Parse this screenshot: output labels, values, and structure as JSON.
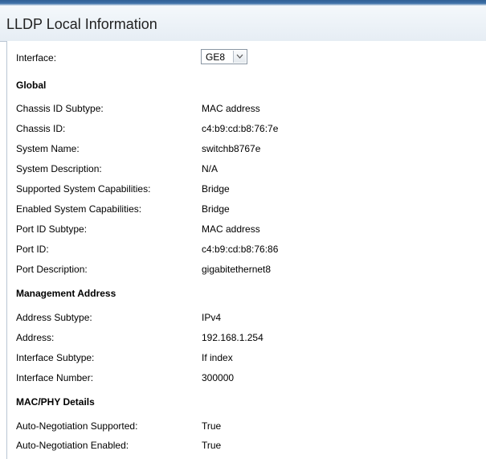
{
  "page": {
    "title": "LLDP Local Information"
  },
  "interface": {
    "label": "Interface:",
    "selected": "GE8"
  },
  "global": {
    "heading": "Global",
    "rows": [
      {
        "label": "Chassis ID Subtype:",
        "value": "MAC address"
      },
      {
        "label": "Chassis ID:",
        "value": "c4:b9:cd:b8:76:7e"
      },
      {
        "label": "System Name:",
        "value": "switchb8767e"
      },
      {
        "label": "System Description:",
        "value": "N/A"
      },
      {
        "label": "Supported System Capabilities:",
        "value": "Bridge"
      },
      {
        "label": "Enabled System Capabilities:",
        "value": "Bridge"
      },
      {
        "label": "Port ID Subtype:",
        "value": "MAC address"
      },
      {
        "label": "Port ID:",
        "value": "c4:b9:cd:b8:76:86"
      },
      {
        "label": "Port Description:",
        "value": "gigabitethernet8"
      }
    ]
  },
  "management": {
    "heading": "Management Address",
    "rows": [
      {
        "label": "Address Subtype:",
        "value": "IPv4"
      },
      {
        "label": "Address:",
        "value": "192.168.1.254"
      },
      {
        "label": "Interface Subtype:",
        "value": "If index"
      },
      {
        "label": "Interface Number:",
        "value": "300000"
      }
    ]
  },
  "macphy": {
    "heading": "MAC/PHY Details",
    "rows": [
      {
        "label": "Auto-Negotiation Supported:",
        "value": "True"
      },
      {
        "label": "Auto-Negotiation Enabled:",
        "value": "True"
      }
    ]
  },
  "icons": {
    "dropdown": "chevron-down-icon"
  }
}
